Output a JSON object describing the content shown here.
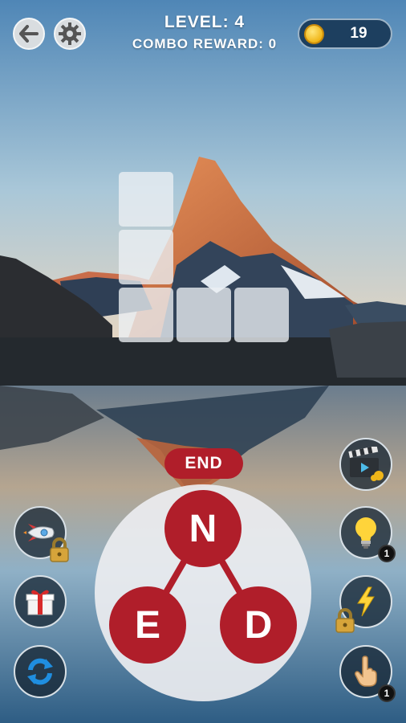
{
  "hud": {
    "level_label": "LEVEL: 4",
    "combo_label": "COMBO REWARD: 0",
    "coins": "19"
  },
  "current_word": "END",
  "letters": [
    "N",
    "E",
    "D"
  ],
  "hint_badge": "1",
  "finger_badge": "1",
  "colors": {
    "accent_red": "#b01e2a",
    "coin_gold": "#f0b619",
    "coin_bar": "#1d3f5f"
  },
  "icons": [
    "back-arrow-icon",
    "settings-gear-icon",
    "coin-icon",
    "video-clapper-icon",
    "lightbulb-icon",
    "lightning-icon",
    "finger-tap-icon",
    "rocket-icon",
    "gift-icon",
    "shuffle-icon",
    "lock-icon"
  ]
}
